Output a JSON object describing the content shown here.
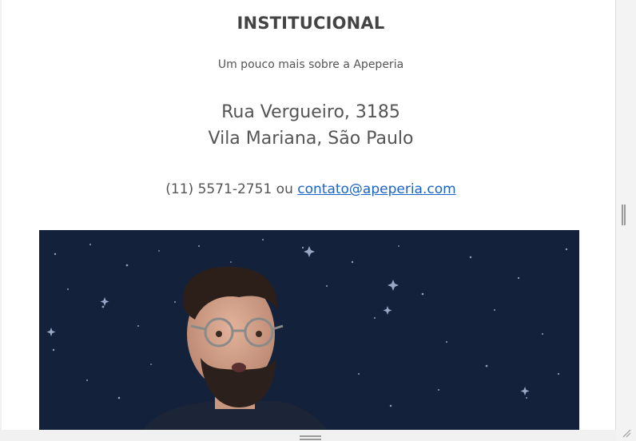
{
  "section": {
    "title": "INSTITUCIONAL",
    "subtitle": "Um pouco mais sobre a Apeperia"
  },
  "address": {
    "line1": "Rua Vergueiro, 3185",
    "line2": "Vila Mariana, São Paulo"
  },
  "contact": {
    "phone_text": "(11) 5571-2751 ou ",
    "email": "contato@apeperia.com"
  },
  "colors": {
    "video_background": "#14213b",
    "link": "#1a63c8",
    "text": "#555555"
  }
}
